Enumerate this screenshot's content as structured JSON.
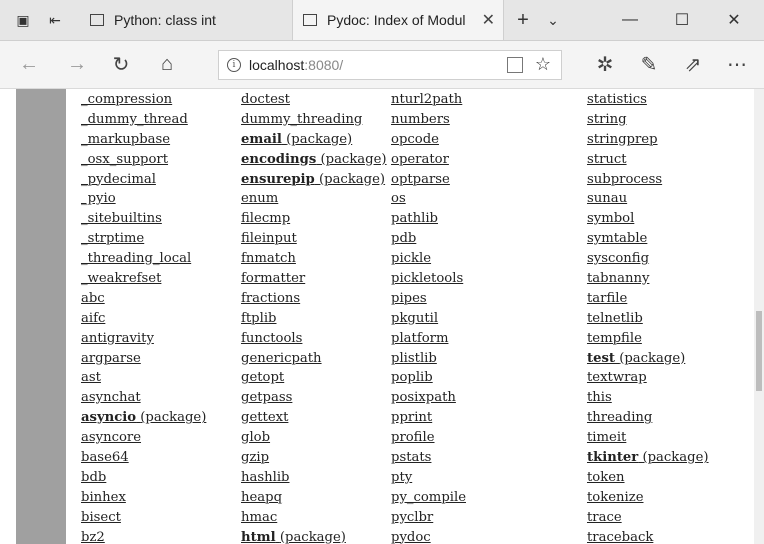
{
  "browser": {
    "tabs": [
      {
        "title": "Python: class int"
      },
      {
        "title": "Pydoc: Index of Modul"
      }
    ],
    "url": {
      "host": "localhost",
      "port": ":8080/"
    }
  },
  "modules": {
    "col1": [
      {
        "name": "_compression"
      },
      {
        "name": "_dummy_thread"
      },
      {
        "name": "_markupbase"
      },
      {
        "name": "_osx_support"
      },
      {
        "name": "_pydecimal"
      },
      {
        "name": "_pyio"
      },
      {
        "name": "_sitebuiltins"
      },
      {
        "name": "_strptime"
      },
      {
        "name": "_threading_local"
      },
      {
        "name": "_weakrefset"
      },
      {
        "name": "abc"
      },
      {
        "name": "aifc"
      },
      {
        "name": "antigravity"
      },
      {
        "name": "argparse"
      },
      {
        "name": "ast"
      },
      {
        "name": "asynchat"
      },
      {
        "name": "asyncio",
        "pkg": "(package)"
      },
      {
        "name": "asyncore"
      },
      {
        "name": "base64"
      },
      {
        "name": "bdb"
      },
      {
        "name": "binhex"
      },
      {
        "name": "bisect"
      },
      {
        "name": "bz2"
      }
    ],
    "col2": [
      {
        "name": "doctest"
      },
      {
        "name": "dummy_threading"
      },
      {
        "name": "email",
        "pkg": "(package)"
      },
      {
        "name": "encodings",
        "pkg": "(package)"
      },
      {
        "name": "ensurepip",
        "pkg": "(package)"
      },
      {
        "name": "enum"
      },
      {
        "name": "filecmp"
      },
      {
        "name": "fileinput"
      },
      {
        "name": "fnmatch"
      },
      {
        "name": "formatter"
      },
      {
        "name": "fractions"
      },
      {
        "name": "ftplib"
      },
      {
        "name": "functools"
      },
      {
        "name": "genericpath"
      },
      {
        "name": "getopt"
      },
      {
        "name": "getpass"
      },
      {
        "name": "gettext"
      },
      {
        "name": "glob"
      },
      {
        "name": "gzip"
      },
      {
        "name": "hashlib"
      },
      {
        "name": "heapq"
      },
      {
        "name": "hmac"
      },
      {
        "name": "html",
        "pkg": "(package)"
      }
    ],
    "col3": [
      {
        "name": "nturl2path"
      },
      {
        "name": "numbers"
      },
      {
        "name": "opcode"
      },
      {
        "name": "operator"
      },
      {
        "name": "optparse"
      },
      {
        "name": "os"
      },
      {
        "name": "pathlib"
      },
      {
        "name": "pdb"
      },
      {
        "name": "pickle"
      },
      {
        "name": "pickletools"
      },
      {
        "name": "pipes"
      },
      {
        "name": "pkgutil"
      },
      {
        "name": "platform"
      },
      {
        "name": "plistlib"
      },
      {
        "name": "poplib"
      },
      {
        "name": "posixpath"
      },
      {
        "name": "pprint"
      },
      {
        "name": "profile"
      },
      {
        "name": "pstats"
      },
      {
        "name": "pty"
      },
      {
        "name": "py_compile"
      },
      {
        "name": "pyclbr"
      },
      {
        "name": "pydoc"
      }
    ],
    "col4": [
      {
        "name": "statistics"
      },
      {
        "name": "string"
      },
      {
        "name": "stringprep"
      },
      {
        "name": "struct"
      },
      {
        "name": "subprocess"
      },
      {
        "name": "sunau"
      },
      {
        "name": "symbol"
      },
      {
        "name": "symtable"
      },
      {
        "name": "sysconfig"
      },
      {
        "name": "tabnanny"
      },
      {
        "name": "tarfile"
      },
      {
        "name": "telnetlib"
      },
      {
        "name": "tempfile"
      },
      {
        "name": "test",
        "pkg": "(package)"
      },
      {
        "name": "textwrap"
      },
      {
        "name": "this"
      },
      {
        "name": "threading"
      },
      {
        "name": "timeit"
      },
      {
        "name": "tkinter",
        "pkg": "(package)"
      },
      {
        "name": "token"
      },
      {
        "name": "tokenize"
      },
      {
        "name": "trace"
      },
      {
        "name": "traceback"
      }
    ]
  }
}
